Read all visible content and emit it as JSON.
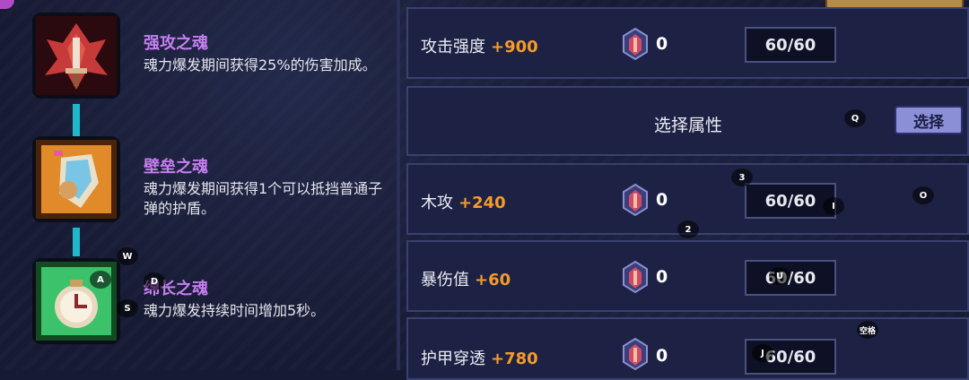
{
  "souls": [
    {
      "title": "强攻之魂",
      "description": "魂力爆发期间获得25%的伤害加成。",
      "icon": "strength-soul-icon",
      "frame_color": "#c73a3a"
    },
    {
      "title": "壁垒之魂",
      "description": "魂力爆发期间获得1个可以抵挡普通子弹的护盾。",
      "icon": "barrier-soul-icon",
      "frame_color": "#e08a2a"
    },
    {
      "title": "绵长之魂",
      "description": "魂力爆发持续时间增加5秒。",
      "icon": "longevity-soul-icon",
      "frame_color": "#3cc26a"
    }
  ],
  "attributes": [
    {
      "label": "攻击强度",
      "bonus": "+900",
      "count": "0",
      "value": "60/60"
    },
    {
      "label": "木攻",
      "bonus": "+240",
      "count": "0",
      "value": "60/60"
    },
    {
      "label": "暴伤值",
      "bonus": "+60",
      "count": "0",
      "value": "60/60"
    },
    {
      "label": "护甲穿透",
      "bonus": "+780",
      "count": "0",
      "value": "60/60"
    }
  ],
  "select_row": {
    "label": "选择属性",
    "button_label": "选择"
  },
  "key_hints": {
    "q": "Q",
    "three": "3",
    "two": "2",
    "i": "I",
    "o": "O",
    "w": "W",
    "a": "A",
    "d": "D",
    "s": "S",
    "u": "U",
    "space": "空格",
    "j": "J"
  },
  "colors": {
    "background": "#161a33",
    "bonus": "#f59a2b",
    "soul_title": "#c67ff0",
    "connector": "#1fb8c8",
    "select_button": "#8a8fd6"
  }
}
